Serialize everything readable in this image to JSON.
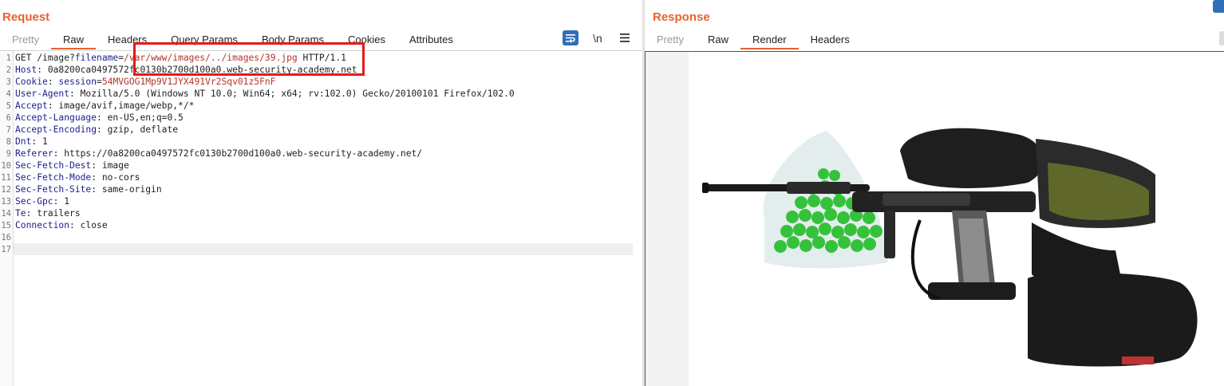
{
  "request": {
    "title": "Request",
    "tabs": [
      {
        "label": "Pretty",
        "state": "muted"
      },
      {
        "label": "Raw",
        "state": "active"
      },
      {
        "label": "Headers",
        "state": ""
      },
      {
        "label": "Query Params",
        "state": ""
      },
      {
        "label": "Body Params",
        "state": ""
      },
      {
        "label": "Cookies",
        "state": ""
      },
      {
        "label": "Attributes",
        "state": ""
      }
    ],
    "tools": {
      "wrap_icon": "wrap-lines-icon",
      "newline_label": "\\n",
      "menu_icon": "hamburger-menu-icon"
    },
    "lines": [
      {
        "n": "1",
        "parts": [
          [
            "GET /image?",
            ""
          ],
          [
            "filename",
            "kw"
          ],
          [
            "=",
            ""
          ],
          [
            "/var/www/images/../images/39.jpg",
            "path"
          ],
          [
            " HTTP/1.1",
            ""
          ]
        ]
      },
      {
        "n": "2",
        "parts": [
          [
            "Host",
            "kw"
          ],
          [
            ": 0a8200ca0497572fc0130b2700d100a0.web-security-academy.net",
            ""
          ]
        ]
      },
      {
        "n": "3",
        "parts": [
          [
            "Cookie",
            "kw"
          ],
          [
            ": ",
            ""
          ],
          [
            "session",
            "kw"
          ],
          [
            "=",
            ""
          ],
          [
            "54MVGOG1Mp9V1JYX491Vr2Sqv01z5FnF",
            "cookie-val"
          ]
        ]
      },
      {
        "n": "4",
        "parts": [
          [
            "User-Agent",
            "kw"
          ],
          [
            ": Mozilla/5.0 (Windows NT 10.0; Win64; x64; rv:102.0) Gecko/20100101 Firefox/102.0",
            ""
          ]
        ]
      },
      {
        "n": "5",
        "parts": [
          [
            "Accept",
            "kw"
          ],
          [
            ": image/avif,image/webp,*/*",
            ""
          ]
        ]
      },
      {
        "n": "6",
        "parts": [
          [
            "Accept-Language",
            "kw"
          ],
          [
            ": en-US,en;q=0.5",
            ""
          ]
        ]
      },
      {
        "n": "7",
        "parts": [
          [
            "Accept-Encoding",
            "kw"
          ],
          [
            ": gzip, deflate",
            ""
          ]
        ]
      },
      {
        "n": "8",
        "parts": [
          [
            "Dnt",
            "kw"
          ],
          [
            ": 1",
            ""
          ]
        ]
      },
      {
        "n": "9",
        "parts": [
          [
            "Referer",
            "kw"
          ],
          [
            ": https://0a8200ca0497572fc0130b2700d100a0.web-security-academy.net/",
            ""
          ]
        ]
      },
      {
        "n": "10",
        "parts": [
          [
            "Sec-Fetch-Dest",
            "kw"
          ],
          [
            ": image",
            ""
          ]
        ]
      },
      {
        "n": "11",
        "parts": [
          [
            "Sec-Fetch-Mode",
            "kw"
          ],
          [
            ": no-cors",
            ""
          ]
        ]
      },
      {
        "n": "12",
        "parts": [
          [
            "Sec-Fetch-Site",
            "kw"
          ],
          [
            ": same-origin",
            ""
          ]
        ]
      },
      {
        "n": "13",
        "parts": [
          [
            "Sec-Gpc",
            "kw"
          ],
          [
            ": 1",
            ""
          ]
        ]
      },
      {
        "n": "14",
        "parts": [
          [
            "Te",
            "kw"
          ],
          [
            ": trailers",
            ""
          ]
        ]
      },
      {
        "n": "15",
        "parts": [
          [
            "Connection",
            "kw"
          ],
          [
            ": close",
            ""
          ]
        ]
      },
      {
        "n": "16",
        "parts": []
      },
      {
        "n": "17",
        "parts": []
      }
    ]
  },
  "response": {
    "title": "Response",
    "tabs": [
      {
        "label": "Pretty",
        "state": "muted"
      },
      {
        "label": "Raw",
        "state": ""
      },
      {
        "label": "Render",
        "state": "active"
      },
      {
        "label": "Headers",
        "state": ""
      }
    ],
    "render_image": "paintball-marker-image"
  },
  "colors": {
    "accent": "#e8622c",
    "header_key": "#1c1d8c",
    "value_red": "#b5342a",
    "highlight_box": "#e81818"
  }
}
